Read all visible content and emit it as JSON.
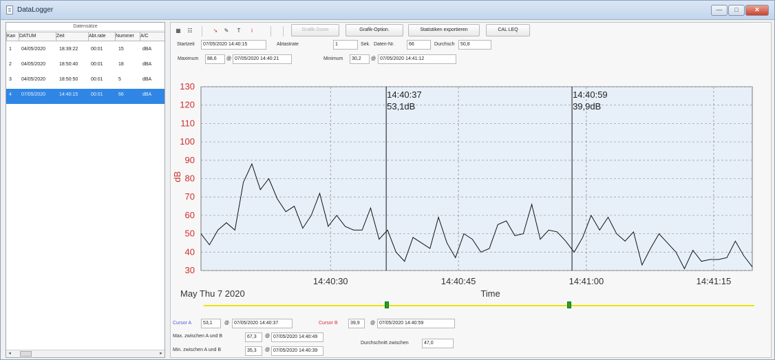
{
  "window": {
    "title": "DataLogger",
    "buttons": {
      "min": "—",
      "max": "□",
      "close": "✕"
    }
  },
  "sidebar": {
    "group_title": "Datensätze",
    "columns": [
      "Kan",
      "DATUM",
      "Zeit",
      "Abt.rate",
      "Nummer",
      "A/C"
    ],
    "rows": [
      {
        "kan": "1",
        "datum": "04/05/2020",
        "zeit": "18:39:22",
        "rate": "00:01",
        "nummer": "15",
        "ac": "dBA",
        "selected": false
      },
      {
        "kan": "2",
        "datum": "04/05/2020",
        "zeit": "18:50:40",
        "rate": "00:01",
        "nummer": "18",
        "ac": "dBA",
        "selected": false
      },
      {
        "kan": "3",
        "datum": "04/05/2020",
        "zeit": "18:50:50",
        "rate": "00:01",
        "nummer": "5",
        "ac": "dBA",
        "selected": false
      },
      {
        "kan": "4",
        "datum": "07/05/2020",
        "zeit": "14:40:15",
        "rate": "00:01",
        "nummer": "66",
        "ac": "dBA",
        "selected": true
      }
    ]
  },
  "toolbar": {
    "icons": [
      {
        "name": "table-icon",
        "glyph": "▦"
      },
      {
        "name": "chart-icon",
        "glyph": "☷"
      },
      {
        "name": "cursor-icon",
        "glyph": "➘"
      },
      {
        "name": "pen-icon",
        "glyph": "✎"
      },
      {
        "name": "text-icon",
        "glyph": "T"
      },
      {
        "name": "info-icon",
        "glyph": "i"
      }
    ],
    "buttons": {
      "zoom": "Grafik-Zoom",
      "options": "Grafik-Option.",
      "export": "Statistiken exportieren",
      "leq": "CAL LEQ"
    }
  },
  "form": {
    "start_label": "Startzeit",
    "start_value": "07/05/2020 14:40:15",
    "rate_label": "Abtastrate",
    "rate_value": "1",
    "sec_label": "Sek.",
    "count_label": "Daten-Nr.",
    "count_value": "66",
    "avg_label": "Durchsch",
    "avg_value": "50,8",
    "max_label": "Maximum",
    "max_value": "88,6",
    "max_time": "07/05/2020 14:40:21",
    "min_label": "Minimum",
    "min_value": "30,2",
    "min_time": "07/05/2020 14:41:12"
  },
  "chart_data": {
    "type": "line",
    "title": "",
    "xlabel": "Time",
    "ylabel": "dB",
    "date_label": "May Thu 7 2020",
    "x_ticks": [
      "14:40:30",
      "14:40:45",
      "14:41:00",
      "14:41:15"
    ],
    "y_ticks": [
      30,
      40,
      50,
      60,
      70,
      80,
      90,
      100,
      110,
      120,
      130
    ],
    "ylim": [
      30,
      130
    ],
    "grid": "on",
    "series": [
      {
        "values": [
          50,
          44,
          52,
          56,
          52,
          78,
          88,
          74,
          80,
          69,
          62,
          65,
          53,
          60,
          72,
          54,
          60,
          54,
          52,
          52,
          64,
          47,
          52,
          40,
          35,
          48,
          45,
          42,
          59,
          45,
          37,
          50,
          47,
          40,
          42,
          55,
          57,
          49,
          50,
          66,
          47,
          52,
          51,
          46,
          40,
          48,
          60,
          52,
          59,
          50,
          46,
          51,
          33,
          42,
          50,
          45,
          40,
          31,
          41,
          35,
          36,
          36,
          37,
          46,
          38,
          32
        ]
      }
    ],
    "cursors": [
      {
        "time": "14:40:37",
        "value": "53,1dB"
      },
      {
        "time": "14:40:59",
        "value": "39,9dB"
      }
    ],
    "slider": {
      "a": 0.333,
      "b": 0.667
    }
  },
  "footer": {
    "cursor_a_label": "Cursor A",
    "cursor_a_value": "53,1",
    "cursor_a_time": "07/05/2020 14:40:37",
    "cursor_b_label": "Cursor B",
    "cursor_b_value": "39,9",
    "cursor_b_time": "07/05/2020 14:40:59",
    "max_between_label": "Max. zwischen A und B",
    "max_between_value": "67,3",
    "max_between_time": "07/05/2020 14:40:49",
    "min_between_label": "Min. zwischen A und B",
    "min_between_value": "35,3",
    "min_between_time": "07/05/2020 14:40:39",
    "avg_between_label": "Durchschnitt zwischen",
    "avg_between_value": "47,0"
  }
}
